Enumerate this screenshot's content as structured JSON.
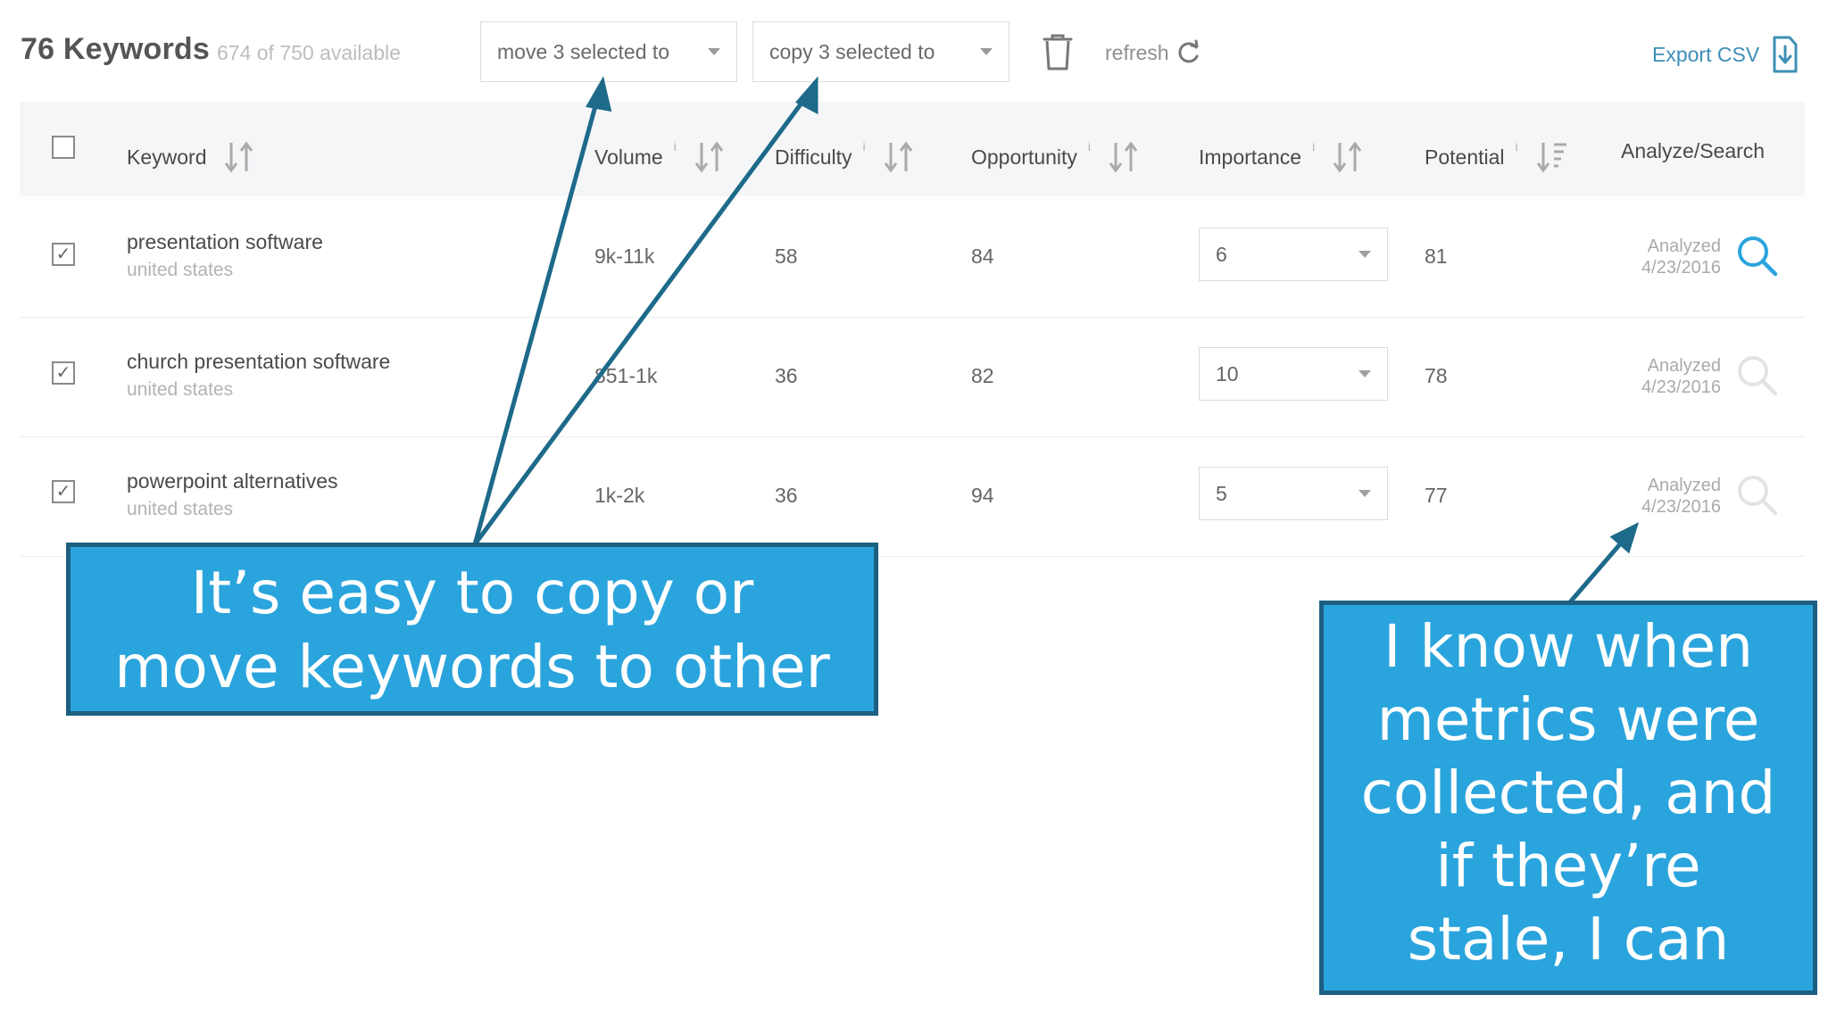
{
  "toolbar": {
    "keyword_count": "76 Keywords",
    "available": "674 of 750 available",
    "move_dropdown": "move 3 selected to",
    "copy_dropdown": "copy 3 selected to",
    "refresh_label": "refresh",
    "export_label": "Export CSV"
  },
  "table": {
    "headers": {
      "keyword": "Keyword",
      "volume": "Volume",
      "difficulty": "Difficulty",
      "opportunity": "Opportunity",
      "importance": "Importance",
      "potential": "Potential",
      "analyze": "Analyze/Search",
      "info": "i"
    },
    "rows": [
      {
        "checked": "✓",
        "keyword": "presentation software",
        "location": "united states",
        "volume": "9k-11k",
        "difficulty": "58",
        "opportunity": "84",
        "importance": "6",
        "potential": "81",
        "analyzed_label": "Analyzed",
        "analyzed_date": "4/23/2016"
      },
      {
        "checked": "✓",
        "keyword": "church presentation software",
        "location": "united states",
        "volume": "851-1k",
        "difficulty": "36",
        "opportunity": "82",
        "importance": "10",
        "potential": "78",
        "analyzed_label": "Analyzed",
        "analyzed_date": "4/23/2016"
      },
      {
        "checked": "✓",
        "keyword": "powerpoint alternatives",
        "location": "united states",
        "volume": "1k-2k",
        "difficulty": "36",
        "opportunity": "94",
        "importance": "5",
        "potential": "77",
        "analyzed_label": "Analyzed",
        "analyzed_date": "4/23/2016"
      }
    ]
  },
  "annotations": {
    "left": {
      "line1": "It’s easy to copy or",
      "line2": "move keywords to other"
    },
    "right": {
      "line1": "I know when",
      "line2": "metrics were",
      "line3": "collected, and",
      "line4": "if they’re",
      "line5": "stale, I can"
    }
  },
  "colors": {
    "callout_fill": "#2aa4dd",
    "callout_border": "#1d5f80",
    "arrow": "#1d6a8a",
    "link": "#3d8fb6",
    "active_search": "#2aa4dd"
  }
}
